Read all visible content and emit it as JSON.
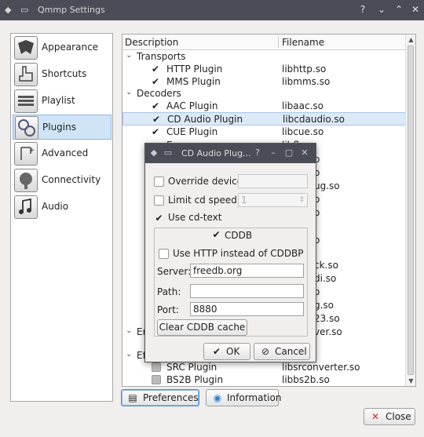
{
  "window": {
    "title": "Qmmp Settings",
    "help_glyph": "?",
    "close_glyph": "✕"
  },
  "categories": [
    {
      "label": "Appearance",
      "icon": "appearance-icon",
      "selected": false
    },
    {
      "label": "Shortcuts",
      "icon": "shortcuts-icon",
      "selected": false
    },
    {
      "label": "Playlist",
      "icon": "playlist-icon",
      "selected": false
    },
    {
      "label": "Plugins",
      "icon": "plugins-icon",
      "selected": true
    },
    {
      "label": "Advanced",
      "icon": "advanced-icon",
      "selected": false
    },
    {
      "label": "Connectivity",
      "icon": "connectivity-icon",
      "selected": false
    },
    {
      "label": "Audio",
      "icon": "audio-icon",
      "selected": false
    }
  ],
  "tree": {
    "headers": {
      "description": "Description",
      "filename": "Filename"
    },
    "rows": [
      {
        "type": "group",
        "label": "Transports"
      },
      {
        "type": "plugin",
        "label": "HTTP Plugin",
        "file": "libhttp.so",
        "checked": true
      },
      {
        "type": "plugin",
        "label": "MMS Plugin",
        "file": "libmms.so",
        "checked": true
      },
      {
        "type": "group",
        "label": "Decoders"
      },
      {
        "type": "plugin",
        "label": "AAC Plugin",
        "file": "libaac.so",
        "checked": true
      },
      {
        "type": "plugin",
        "label": "CD Audio Plugin",
        "file": "libcdaudio.so",
        "checked": true,
        "selected": true
      },
      {
        "type": "plugin",
        "label": "CUE Plugin",
        "file": "libcue.so",
        "checked": true
      }
    ],
    "partial_rows": [
      {
        "label": "E",
        "file": "libfl"
      },
      {
        "label": "",
        "file": "o"
      },
      {
        "label": "",
        "file": "o"
      },
      {
        "label": "",
        "file": "ug.so"
      },
      {
        "label": "",
        "file": "o"
      },
      {
        "label": "",
        "file": "o"
      },
      {
        "label": "",
        "file": "o"
      },
      {
        "label": "",
        "file": "ck.so"
      },
      {
        "label": "",
        "file": "di.so"
      },
      {
        "label": "",
        "file": "o"
      },
      {
        "label": "",
        "file": "g.so"
      },
      {
        "label": "",
        "file": "23.so"
      },
      {
        "label": "Er",
        "file": "ver.so"
      },
      {
        "label": "Ef",
        "file": ""
      }
    ],
    "bottom_rows": [
      {
        "label": "SRC Plugin",
        "file": "libsrconverter.so",
        "checked": false
      },
      {
        "label": "BS2B Plugin",
        "file": "libbs2b.so",
        "checked": false
      }
    ]
  },
  "buttons": {
    "preferences": "Preferences",
    "information": "Information",
    "close": "Close"
  },
  "dialog": {
    "title": "CD Audio Plug...",
    "help_glyph": "?",
    "override_device": {
      "label": "Override device:",
      "checked": false,
      "value": ""
    },
    "limit_speed": {
      "label": "Limit cd speed:",
      "checked": false,
      "value": "1"
    },
    "use_cd_text": {
      "label": "Use cd-text",
      "checked": true
    },
    "cddb": {
      "label": "CDDB",
      "checked": true
    },
    "use_http": {
      "label": "Use HTTP instead of CDDBP",
      "checked": false
    },
    "server": {
      "label": "Server:",
      "value": "freedb.org"
    },
    "path": {
      "label": "Path:",
      "value": ""
    },
    "port": {
      "label": "Port:",
      "value": "8880"
    },
    "clear_cache": "Clear CDDB cache",
    "ok": "OK",
    "cancel": "Cancel"
  },
  "colors": {
    "titlebar": "#4a4d55",
    "selection": "#cfe4f7",
    "window_bg": "#f0efee"
  }
}
